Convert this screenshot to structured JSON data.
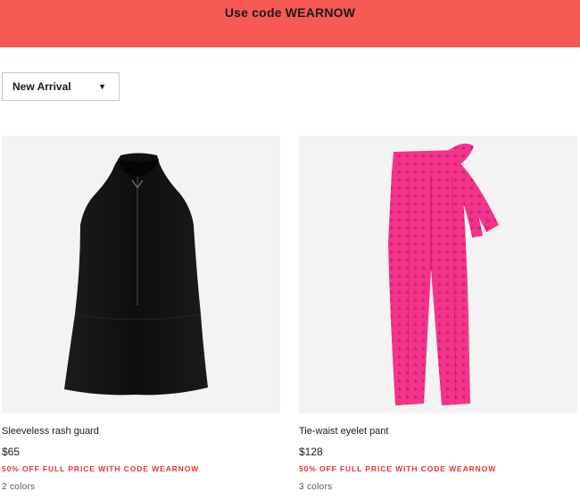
{
  "banner": {
    "text": "Use code WEARNOW"
  },
  "sort": {
    "selected": "New Arrival",
    "icon": "caret-down-icon"
  },
  "products": [
    {
      "name": "Sleeveless rash guard",
      "price": "$65",
      "promo": "50% OFF FULL PRICE WITH CODE WEARNOW",
      "colors": "2 colors",
      "image": "black-sleeveless-zip-top",
      "color_hex": "#111111"
    },
    {
      "name": "Tie-waist eyelet pant",
      "price": "$128",
      "promo": "50% OFF FULL PRICE WITH CODE WEARNOW",
      "colors": "3 colors",
      "image": "pink-eyelet-pants",
      "color_hex": "#f0307f"
    }
  ],
  "theme": {
    "banner_bg": "#f65a55",
    "promo_red": "#e8322f"
  }
}
